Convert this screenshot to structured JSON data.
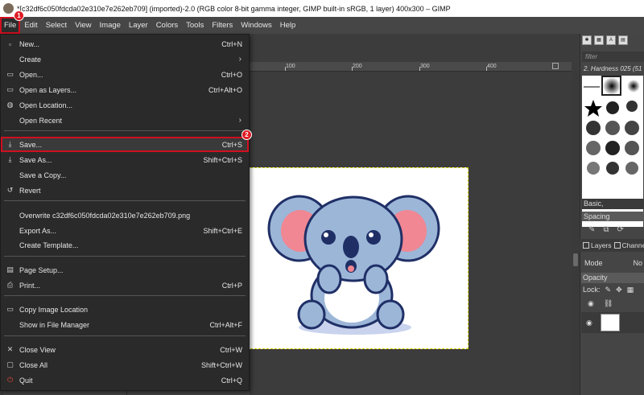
{
  "window": {
    "title": "*[c32df6c050fdcda02e310e7e262eb709] (imported)-2.0 (RGB color 8-bit gamma integer, GIMP built-in sRGB, 1 layer) 400x300 – GIMP"
  },
  "menubar": {
    "items": [
      "File",
      "Edit",
      "Select",
      "View",
      "Image",
      "Layer",
      "Colors",
      "Tools",
      "Filters",
      "Windows",
      "Help"
    ]
  },
  "badges": {
    "file": "1",
    "save": "2"
  },
  "file_menu": {
    "items": [
      {
        "label": "New...",
        "shortcut": "Ctrl+N",
        "icon": "new-icon"
      },
      {
        "label": "Create",
        "shortcut": "",
        "icon": "",
        "submenu": true
      },
      {
        "label": "Open...",
        "shortcut": "Ctrl+O",
        "icon": "open-icon"
      },
      {
        "label": "Open as Layers...",
        "shortcut": "Ctrl+Alt+O",
        "icon": "open-layers-icon"
      },
      {
        "label": "Open Location...",
        "shortcut": "",
        "icon": "globe-icon"
      },
      {
        "label": "Open Recent",
        "shortcut": "",
        "icon": "",
        "submenu": true
      },
      {
        "label": "Save...",
        "shortcut": "Ctrl+S",
        "icon": "save-icon"
      },
      {
        "label": "Save As...",
        "shortcut": "Shift+Ctrl+S",
        "icon": "save-as-icon"
      },
      {
        "label": "Save a Copy...",
        "shortcut": "",
        "icon": ""
      },
      {
        "label": "Revert",
        "shortcut": "",
        "icon": "revert-icon"
      },
      {
        "label": "Overwrite c32df6c050fdcda02e310e7e262eb709.png",
        "shortcut": "",
        "icon": ""
      },
      {
        "label": "Export As...",
        "shortcut": "Shift+Ctrl+E",
        "icon": ""
      },
      {
        "label": "Create Template...",
        "shortcut": "",
        "icon": ""
      },
      {
        "label": "Page Setup...",
        "shortcut": "",
        "icon": "page-setup-icon"
      },
      {
        "label": "Print...",
        "shortcut": "Ctrl+P",
        "icon": "print-icon"
      },
      {
        "label": "Copy Image Location",
        "shortcut": "",
        "icon": "copy-location-icon"
      },
      {
        "label": "Show in File Manager",
        "shortcut": "Ctrl+Alt+F",
        "icon": ""
      },
      {
        "label": "Close View",
        "shortcut": "Ctrl+W",
        "icon": "close-icon"
      },
      {
        "label": "Close All",
        "shortcut": "Shift+Ctrl+W",
        "icon": "close-all-icon"
      },
      {
        "label": "Quit",
        "shortcut": "Ctrl+Q",
        "icon": "quit-icon"
      }
    ]
  },
  "ruler": {
    "ticks": [
      "100",
      "200",
      "300",
      "400",
      "500"
    ]
  },
  "brushes": {
    "filter_placeholder": "filter",
    "current_brush": "2. Hardness 025 (51",
    "preset": "Basic,",
    "spacing_label": "Spacing"
  },
  "layers_panel": {
    "tabs": [
      "Layers",
      "Channe"
    ],
    "mode_label": "Mode",
    "mode_value": "No",
    "opacity_label": "Opacity",
    "lock_label": "Lock:"
  }
}
